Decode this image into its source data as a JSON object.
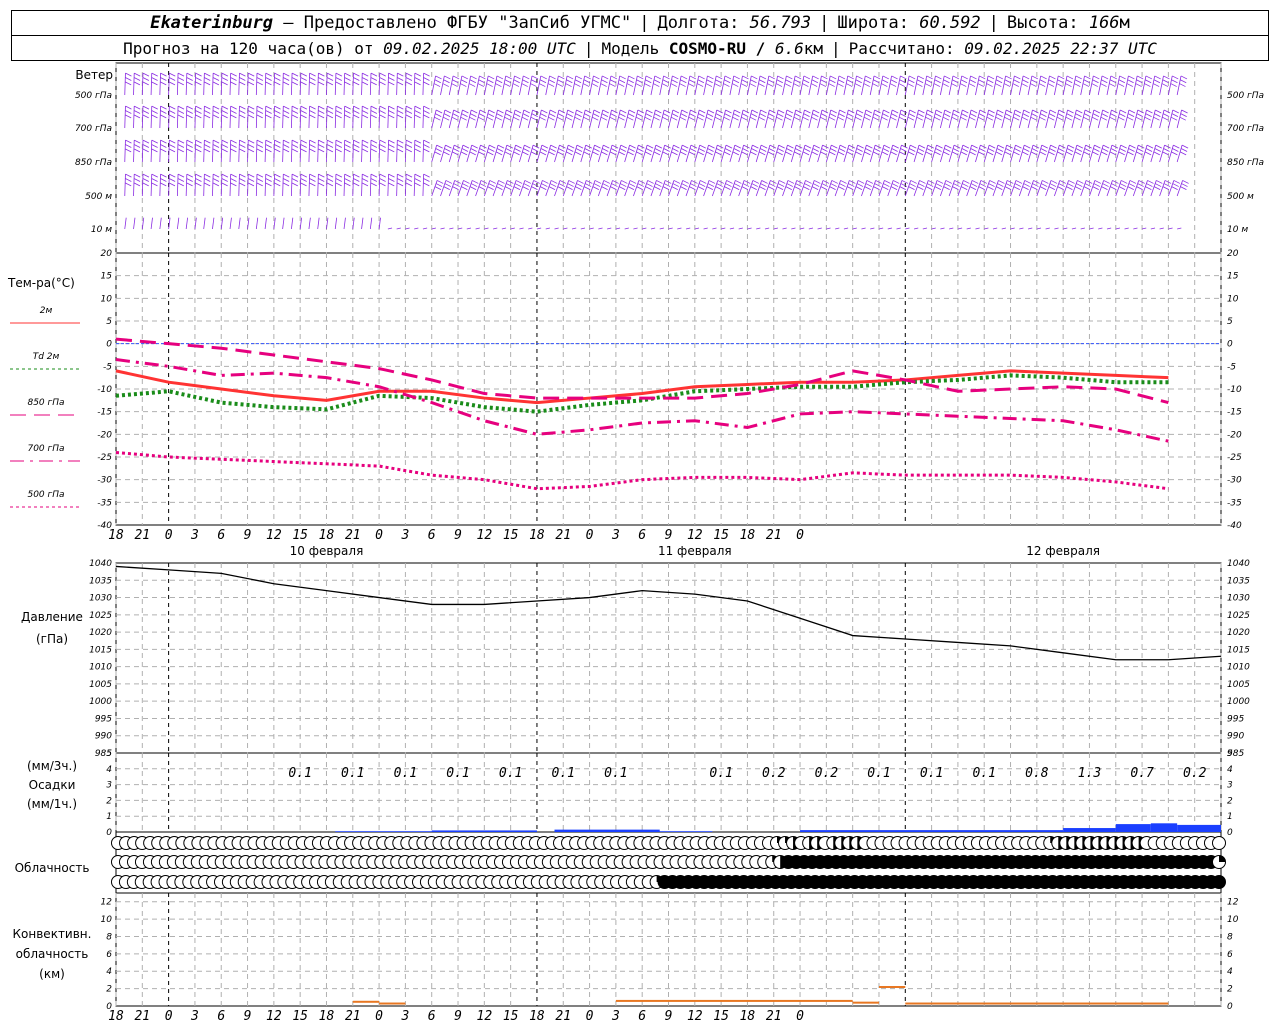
{
  "header": {
    "station": "Ekaterinburg",
    "provider": "– Предоставлено ФГБУ \"ЗапСиб УГМС\"",
    "lon_label": "Долгота:",
    "lon_value": "56.793",
    "lat_label": "Широта:",
    "lat_value": "60.592",
    "alt_label": "Высота:",
    "alt_value": "166",
    "alt_unit": "м",
    "forecast_prefix": "Прогноз на 120 часа(ов) от",
    "forecast_time": "09.02.2025 18:00 UTC",
    "model_label": "Модель",
    "model_name": "COSMO-RU /",
    "model_res": "6.6",
    "model_res_unit": "км",
    "calc_label": "Рассчитано:",
    "calc_time": "09.02.2025 22:37 UTC"
  },
  "chart_data": [
    {
      "type": "wind-barbs",
      "title": "Ветер",
      "levels": [
        "500 гПа",
        "700 гПа",
        "850 гПа",
        "500 м",
        "10 м"
      ],
      "color": "#8a2be2"
    },
    {
      "type": "line",
      "title": "Тем-ра(°C)",
      "ylim": [
        -40,
        20
      ],
      "yticks": [
        20,
        15,
        10,
        5,
        0,
        -5,
        -10,
        -15,
        -20,
        -25,
        -30,
        -35,
        -40
      ],
      "x_hours": [
        0,
        6,
        12,
        18,
        24,
        30,
        36,
        42,
        48,
        54,
        60,
        66,
        72,
        78,
        84,
        90,
        96,
        102,
        108,
        114,
        120
      ],
      "series": [
        {
          "name": "2м",
          "color": "#ff3333",
          "style": "solid",
          "values": [
            -6,
            -8.5,
            -10,
            -11.5,
            -12.5,
            -10.5,
            -10.5,
            -12,
            -13,
            -12,
            -11,
            -9.5,
            -9,
            -8.5,
            -8.5,
            -8,
            -7,
            -6,
            -6.5,
            -7,
            -7.5
          ]
        },
        {
          "name": "Td 2м",
          "color": "#1a8c1a",
          "style": "dotted",
          "values": [
            -11.5,
            -10.5,
            -13,
            -14,
            -14.5,
            -11.5,
            -12,
            -14,
            -15,
            -13.5,
            -12.5,
            -10.5,
            -10,
            -9.5,
            -9.5,
            -8.5,
            -8,
            -7,
            -7.5,
            -8.5,
            -8.5
          ]
        },
        {
          "name": "850 гПа",
          "color": "#e6007e",
          "style": "dashed",
          "values": [
            1,
            0,
            -1,
            -2.5,
            -4,
            -5.5,
            -8,
            -11,
            -12,
            -12,
            -12,
            -12,
            -11,
            -9,
            -6,
            -8,
            -10.5,
            -10,
            -9.5,
            -10,
            -13
          ]
        },
        {
          "name": "700 гПа",
          "color": "#e6007e",
          "style": "dashdot",
          "values": [
            -3.5,
            -5,
            -7,
            -6.5,
            -7.5,
            -9.5,
            -13,
            -17,
            -20,
            -19,
            -17.5,
            -17,
            -18.5,
            -15.5,
            -15,
            -15.5,
            -16,
            -16.5,
            -17,
            -19,
            -21.5
          ]
        },
        {
          "name": "500 гПа",
          "color": "#e6007e",
          "style": "dotted",
          "values": [
            -24,
            -25,
            -25.5,
            -26,
            -26.5,
            -27,
            -29,
            -30,
            -32,
            -31.5,
            -30,
            -29.5,
            -29.5,
            -30,
            -28.5,
            -29,
            -29,
            -29,
            -29.5,
            -30.5,
            -32
          ]
        }
      ]
    },
    {
      "type": "line",
      "title": "Давление",
      "ylabel": "(гПа)",
      "ylim": [
        985,
        1040
      ],
      "yticks": [
        1040,
        1035,
        1030,
        1025,
        1020,
        1015,
        1010,
        1005,
        1000,
        995,
        990,
        985
      ],
      "x_hours": [
        0,
        6,
        12,
        18,
        24,
        30,
        36,
        42,
        48,
        54,
        60,
        66,
        72,
        78,
        84,
        90,
        96,
        102,
        108,
        114,
        120
      ],
      "series": [
        {
          "name": "p",
          "color": "#000000",
          "values": [
            1039,
            1038,
            1037,
            1034,
            1032,
            1030,
            1028,
            1028,
            1029,
            1030,
            1032,
            1031,
            1029,
            1024,
            1019,
            1018,
            1017,
            1016,
            1014,
            1012,
            1012,
            1013
          ]
        }
      ]
    },
    {
      "type": "bar",
      "title": "Осадки",
      "ylabel_top": "(мм/3ч.)",
      "ylabel_bottom": "(мм/1ч.)",
      "ylim": [
        0,
        5
      ],
      "yticks": [
        5,
        4,
        3,
        2,
        1,
        0
      ],
      "color": "#1a3fff",
      "amounts_3h": [
        {
          "hour": 27,
          "value": "0.1"
        },
        {
          "hour": 33,
          "value": "0.1"
        },
        {
          "hour": 39,
          "value": "0.1"
        },
        {
          "hour": 45,
          "value": "0.1"
        },
        {
          "hour": 51,
          "value": "0.1"
        },
        {
          "hour": 57,
          "value": "0.1"
        },
        {
          "hour": 63,
          "value": "0.1"
        },
        {
          "hour": 75,
          "value": "0.1"
        },
        {
          "hour": 81,
          "value": "0.2"
        },
        {
          "hour": 87,
          "value": "0.2"
        },
        {
          "hour": 93,
          "value": "0.1"
        },
        {
          "hour": 99,
          "value": "0.1"
        },
        {
          "hour": 105,
          "value": "0.1"
        },
        {
          "hour": 111,
          "value": "0.8"
        },
        {
          "hour": 117,
          "value": "1.3"
        },
        {
          "hour": 123,
          "value": "0.7"
        },
        {
          "hour": 129,
          "value": "0.2"
        }
      ],
      "hourly_bars": [
        {
          "from": 25,
          "to": 36,
          "value": 0.05
        },
        {
          "from": 36,
          "to": 48,
          "value": 0.1
        },
        {
          "from": 50,
          "to": 62,
          "value": 0.15
        },
        {
          "from": 62,
          "to": 68,
          "value": 0.05
        },
        {
          "from": 78,
          "to": 108,
          "value": 0.12
        },
        {
          "from": 108,
          "to": 114,
          "value": 0.25
        },
        {
          "from": 114,
          "to": 118,
          "value": 0.5
        },
        {
          "from": 118,
          "to": 121,
          "value": 0.55
        },
        {
          "from": 121,
          "to": 126,
          "value": 0.45
        },
        {
          "from": 126,
          "to": 130,
          "value": 0.35
        },
        {
          "from": 130,
          "to": 134,
          "value": 0.2
        }
      ]
    },
    {
      "type": "cloud-symbols",
      "title": "Облачность",
      "rows": [
        {
          "pattern": "ooooooooooooooooooooooooooooooooooooooooooooooooooooooooooooooooooooooooooooooooooqqHoHHoHHHHoooooooooooooooooooooooqHHHHHHHHHHHoooooooooo"
        },
        {
          "pattern": "ooooooooooooooooooooooooooooooooooooooooooooooooooooooooooooooooooooooooooooooooooqHFFFFFFFFFFFFFFFFFFFFFFFFFFFFFFFFFFFFFFFFFFFFFFFFFFFFFFq"
        },
        {
          "pattern": "ooooooooooooooooooooooooooooooooooooooooooooooooooooooooooooooooooooqFFFFFFFFFFFFFFFFFFFFFFFFFFFFFFFFFFFFFFFFFFFFFFFFFFFFFFFFFFFFFFFFFFFFFFF"
        }
      ]
    },
    {
      "type": "bar",
      "title": "Конвективн.",
      "subtitle": "облачность",
      "ylabel": "(км)",
      "ylim": [
        0,
        13
      ],
      "yticks": [
        12,
        10,
        8,
        6,
        4,
        2,
        0
      ],
      "color": "#e87722",
      "bars": [
        {
          "from": 27,
          "to": 30,
          "value": 0.6
        },
        {
          "from": 30,
          "to": 33,
          "value": 0.4
        },
        {
          "from": 57,
          "to": 84,
          "value": 0.7
        },
        {
          "from": 84,
          "to": 87,
          "value": 0.5
        },
        {
          "from": 87,
          "to": 90,
          "value": 2.3
        },
        {
          "from": 90,
          "to": 120,
          "value": 0.4
        }
      ]
    }
  ],
  "x_axis": {
    "hour_labels": [
      "18",
      "21",
      "0",
      "3",
      "6",
      "9",
      "12",
      "15",
      "18",
      "21",
      "0",
      "3",
      "6",
      "9",
      "12",
      "15",
      "18",
      "21",
      "0",
      "3",
      "6",
      "9",
      "12",
      "15",
      "18",
      "21",
      "0"
    ],
    "days": [
      {
        "label": "10 февраля"
      },
      {
        "label": "11 февраля"
      },
      {
        "label": "12 февраля"
      }
    ]
  }
}
